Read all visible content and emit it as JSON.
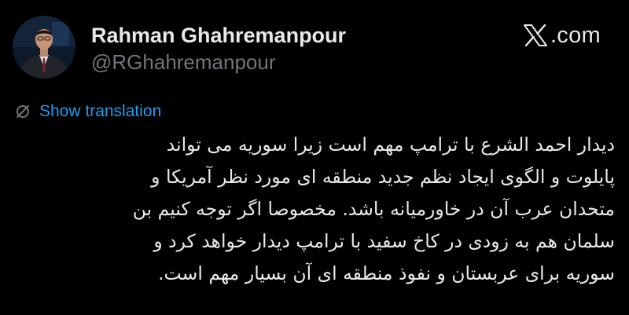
{
  "colors": {
    "background": "#000000",
    "text_primary": "#e7e9ea",
    "text_secondary": "#71767b",
    "link": "#1d9bf0"
  },
  "author": {
    "display_name": "Rahman Ghahremanpour",
    "handle": "@RGhahremanpour",
    "avatar_icon": "profile-photo"
  },
  "brand": {
    "icon": "x-logo-icon",
    "text": ".com"
  },
  "translation": {
    "icon": "globe-translate-icon",
    "label": "Show translation"
  },
  "tweet": {
    "lines": [
      "دیدار احمد الشرع با ترامپ مهم است زیرا سوریه می تواند",
      "پایلوت و الگوی ایجاد نظم جدید منطقه ای مورد نظر آمریکا و",
      "متحدان عرب آن در خاورمیانه باشد. مخصوصا اگر توجه کنیم بن",
      "سلمان هم به زودی در کاخ سفید با ترامپ دیدار خواهد  کرد و",
      "سوریه برای عربستان و نفوذ منطقه ای آن بسیار مهم است."
    ]
  }
}
